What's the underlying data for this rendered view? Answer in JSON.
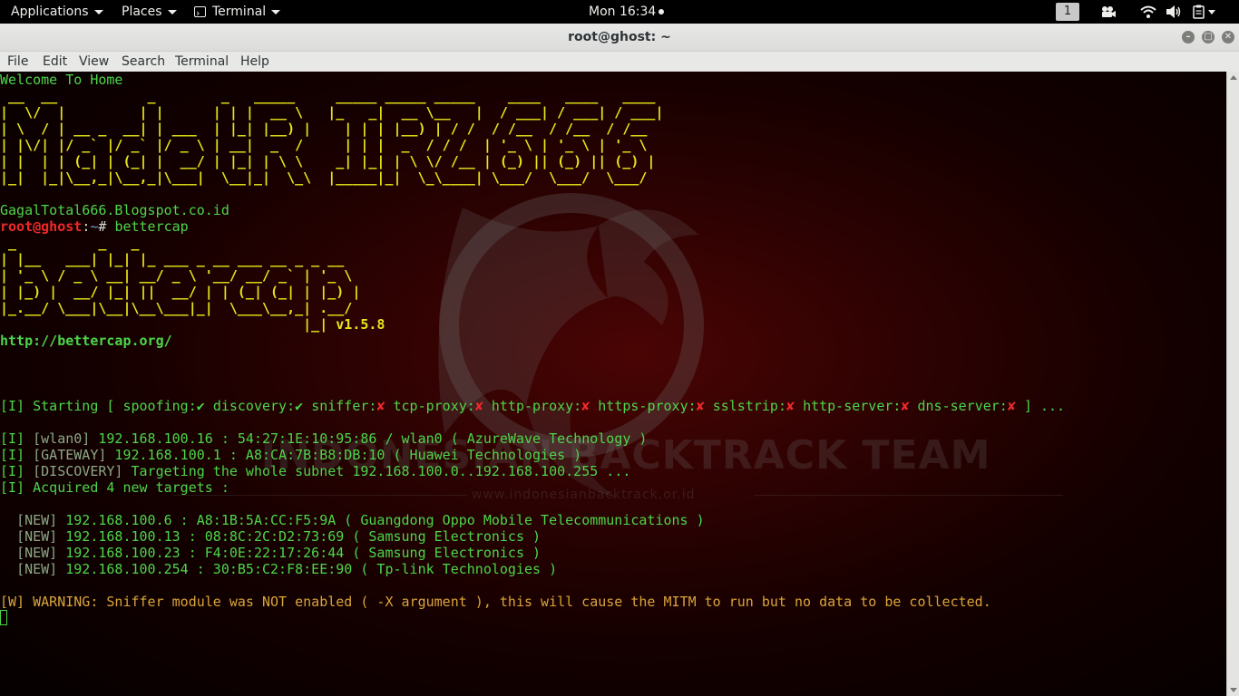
{
  "panel": {
    "applications": "Applications",
    "places": "Places",
    "terminal": "Terminal",
    "clock": "Mon 16:34",
    "workspace": "1"
  },
  "window": {
    "title": "root@ghost: ~"
  },
  "menu": [
    "File",
    "Edit",
    "View",
    "Search",
    "Terminal",
    "Help"
  ],
  "wallpaper": {
    "team": "INDONESIAN BACKTRACK TEAM",
    "url": "www.indonesianbacktrack.or.id"
  },
  "term": {
    "welcome": "Welcome To Home",
    "banner1": [
      " __  __           _        _   _____     _____ _____ _____    ____   ____   ____ ",
      "|  \\/  |         | |      | | |  __ \\   |_   _|  __ \\__   |  / ___| / ___| / ___|",
      "| \\  / | __ _  __| | ___  | |_| |__) |    | | | |__) | / /  / /__  / /__  / /__  ",
      "| |\\/| |/ _` |/ _` |/ _ \\ | __|  _  /     | | |  _  / / /  | '_ \\ | '_ \\ | '_ \\ ",
      "| |  | | (_| | (_| |  __/ | |_| | \\ \\    _| |_| | \\ \\/ /__ | (_) || (_) || (_) |",
      "|_|  |_|\\__,_|\\__,_|\\___|  \\__|_|  \\_\\  |_____|_|  \\_\\____| \\___/  \\___/  \\___/ "
    ],
    "blog": "GagalTotal666.Blogspot.co.id",
    "prompt_user": "root@ghost",
    "prompt_sep": ":",
    "prompt_path": "~",
    "prompt_hash": "# ",
    "command": "bettercap",
    "banner2": [
      " _          _   _                       ",
      "| |__   ___| |_| |_ ___ _ __ ___ __ _ _ __  ",
      "| '_ \\ / _ \\ __| __/ _ \\ '__/ __/ _` | '_ \\ ",
      "| |_) |  __/ |_| ||  __/ | | (_| (_| | |_) |",
      "|_.__/ \\___|\\__|\\__\\___|_|  \\___\\__,_| .__/ "
    ],
    "banner2_tail": "                                     |_| ",
    "version": "v1.5.8",
    "site": "http://bettercap.org/",
    "starting_prefix": "[I] Starting [ ",
    "modules": [
      {
        "name": "spoofing",
        "on": true
      },
      {
        "name": "discovery",
        "on": true
      },
      {
        "name": "sniffer",
        "on": false
      },
      {
        "name": "tcp-proxy",
        "on": false
      },
      {
        "name": "http-proxy",
        "on": false
      },
      {
        "name": "https-proxy",
        "on": false
      },
      {
        "name": "sslstrip",
        "on": false
      },
      {
        "name": "http-server",
        "on": false
      },
      {
        "name": "dns-server",
        "on": false
      }
    ],
    "starting_suffix": "] ...",
    "check": "✔",
    "cross": "✘",
    "info": [
      {
        "tag": "[wlan0]",
        "text": " 192.168.100.16 : 54:27:1E:10:95:86 / wlan0 ( AzureWave Technology )"
      },
      {
        "tag": "[GATEWAY]",
        "text": " 192.168.100.1 : A8:CA:7B:B8:DB:10 ( Huawei Technologies )"
      },
      {
        "tag": "[DISCOVERY]",
        "text": " Targeting the whole subnet 192.168.100.0..192.168.100.255 ..."
      }
    ],
    "info_prefix": "[I] ",
    "acquired": "[I] Acquired 4 new targets :",
    "targets": [
      {
        "tag": "[NEW]",
        "text": " 192.168.100.6 : A8:1B:5A:CC:F5:9A ( Guangdong Oppo Mobile Telecommunications )"
      },
      {
        "tag": "[NEW]",
        "text": " 192.168.100.13 : 08:8C:2C:D2:73:69 ( Samsung Electronics )"
      },
      {
        "tag": "[NEW]",
        "text": " 192.168.100.23 : F4:0E:22:17:26:44 ( Samsung Electronics )"
      },
      {
        "tag": "[NEW]",
        "text": " 192.168.100.254 : 30:B5:C2:F8:EE:90 ( Tp-link Technologies )"
      }
    ],
    "warning_tag": "[W]",
    "warning": " WARNING: Sniffer module was NOT enabled ( -X argument ), this will cause the MITM to run but no data to be collected."
  }
}
